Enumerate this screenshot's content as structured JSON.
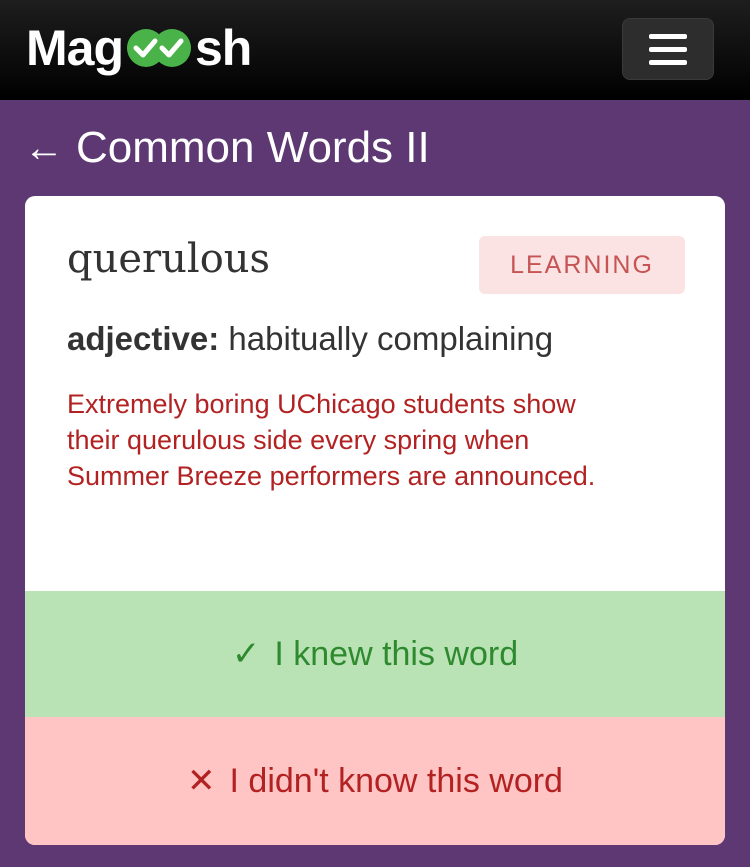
{
  "header": {
    "logo_left": "Mag",
    "logo_right": "sh",
    "logo_icon": "double-check-icon",
    "menu_icon": "hamburger-menu-icon"
  },
  "nav": {
    "back_arrow": "←",
    "title": "Common Words II"
  },
  "card": {
    "word": "querulous",
    "status_badge": "LEARNING",
    "part_of_speech": "adjective:",
    "definition": "habitually complaining",
    "example": "Extremely boring UChicago students show their querulous side every spring when Summer Breeze performers are announced."
  },
  "actions": {
    "knew_icon": "✓",
    "knew_label": "I knew this word",
    "didnt_icon": "✕",
    "didnt_label": "I didn't know this word"
  },
  "colors": {
    "page_bg": "#5d3872",
    "header_bg": "#000000",
    "logo_check": "#49b349",
    "knew_bg": "#b9e3b5",
    "knew_text": "#2f8a2f",
    "didnt_bg": "#ffc4c4",
    "didnt_text": "#b22222",
    "badge_bg": "#fbe3e3",
    "badge_text": "#c65454"
  }
}
